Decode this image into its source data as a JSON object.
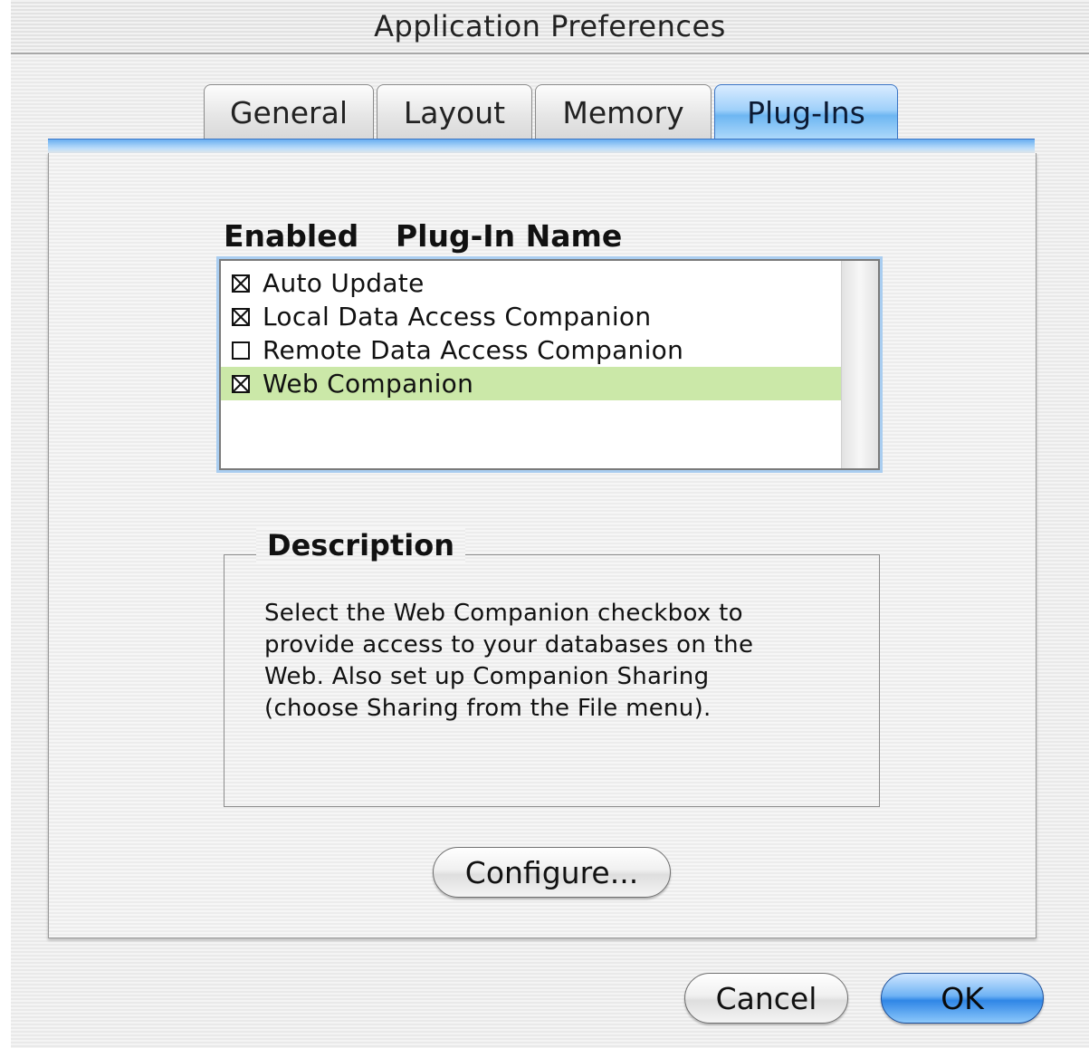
{
  "window": {
    "title": "Application Preferences"
  },
  "tabs": [
    {
      "label": "General",
      "active": false
    },
    {
      "label": "Layout",
      "active": false
    },
    {
      "label": "Memory",
      "active": false
    },
    {
      "label": "Plug-Ins",
      "active": true
    }
  ],
  "plugins": {
    "headers": {
      "enabled": "Enabled",
      "name": "Plug-In Name"
    },
    "items": [
      {
        "label": "Auto Update",
        "enabled": true,
        "selected": false
      },
      {
        "label": "Local Data Access Companion",
        "enabled": true,
        "selected": false
      },
      {
        "label": "Remote Data Access Companion",
        "enabled": false,
        "selected": false
      },
      {
        "label": "Web Companion",
        "enabled": true,
        "selected": true
      }
    ]
  },
  "description": {
    "title": "Description",
    "lines": [
      "Select the Web Companion checkbox to",
      "provide access to your databases on the",
      "Web. Also set up Companion Sharing",
      "(choose Sharing from the File menu)."
    ]
  },
  "buttons": {
    "configure": "Configure...",
    "cancel": "Cancel",
    "ok": "OK"
  },
  "colors": {
    "selection": "#cbe8a8",
    "accent": "#6db6f2"
  }
}
